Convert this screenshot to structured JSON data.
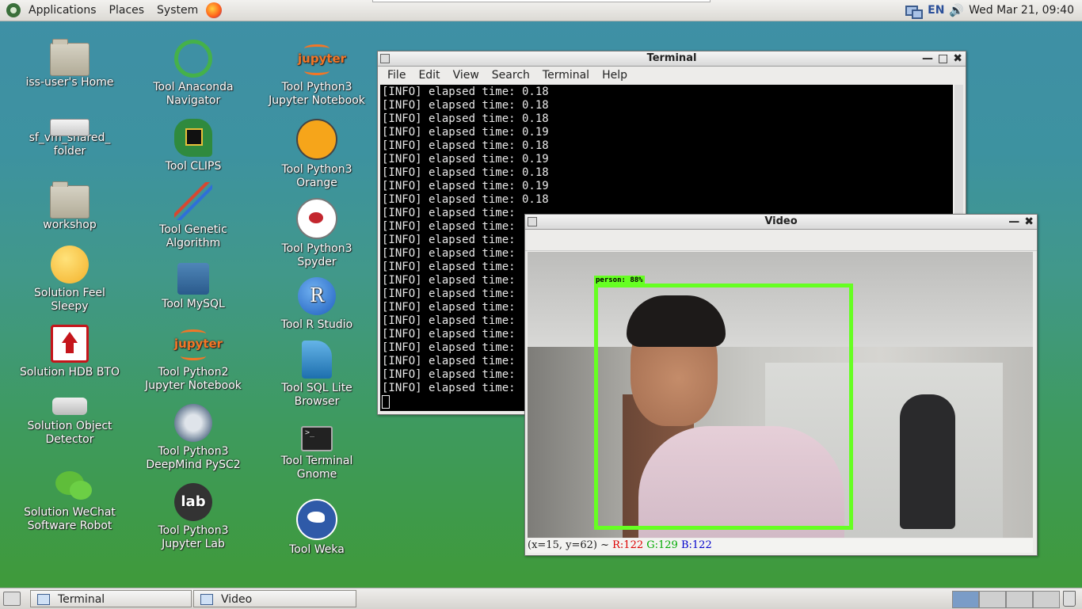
{
  "top_panel": {
    "menus": [
      "Applications",
      "Places",
      "System"
    ],
    "language": "EN",
    "clock": "Wed Mar 21, 09:40"
  },
  "desktop_icons": {
    "col1": [
      {
        "label": "iss-user's Home",
        "icon": "home-folder-icon"
      },
      {
        "label": "sf_vm_shared_\nfolder",
        "icon": "drive-icon"
      },
      {
        "label": "workshop",
        "icon": "folder-icon"
      },
      {
        "label": "Solution Feel\nSleepy",
        "icon": "sleepy-face-icon"
      },
      {
        "label": "Solution HDB BTO",
        "icon": "hdb-house-icon"
      },
      {
        "label": "Solution Object\nDetector",
        "icon": "security-camera-icon"
      },
      {
        "label": "Solution WeChat\nSoftware Robot",
        "icon": "wechat-icon"
      }
    ],
    "col2": [
      {
        "label": "Tool Anaconda\nNavigator",
        "icon": "anaconda-icon"
      },
      {
        "label": "Tool CLIPS",
        "icon": "clips-icon"
      },
      {
        "label": "Tool Genetic\nAlgorithm",
        "icon": "dna-icon"
      },
      {
        "label": "Tool MySQL",
        "icon": "mysql-icon"
      },
      {
        "label": "Tool Python2\nJupyter Notebook",
        "icon": "jupyter-icon"
      },
      {
        "label": "Tool Python3\nDeepMind PySC2",
        "icon": "starcraft-icon"
      },
      {
        "label": "Tool Python3\nJupyter Lab",
        "icon": "jupyterlab-icon"
      }
    ],
    "col3": [
      {
        "label": "Tool Python3\nJupyter Notebook",
        "icon": "jupyter-icon"
      },
      {
        "label": "Tool Python3\nOrange",
        "icon": "orange-icon"
      },
      {
        "label": "Tool Python3\nSpyder",
        "icon": "spyder-icon"
      },
      {
        "label": "Tool R Studio",
        "icon": "rstudio-icon"
      },
      {
        "label": "Tool SQL Lite\nBrowser",
        "icon": "sqlite-icon"
      },
      {
        "label": "Tool Terminal\nGnome",
        "icon": "terminal-icon"
      },
      {
        "label": "Tool Weka",
        "icon": "weka-icon"
      }
    ]
  },
  "icon_glyph_text": {
    "jupyter": "jupyter",
    "lab": "lab",
    "r": "R",
    "term": ">_"
  },
  "terminal": {
    "title": "Terminal",
    "menu": [
      "File",
      "Edit",
      "View",
      "Search",
      "Terminal",
      "Help"
    ],
    "lines": [
      "[INFO] elapsed time: 0.18",
      "[INFO] elapsed time: 0.18",
      "[INFO] elapsed time: 0.18",
      "[INFO] elapsed time: 0.19",
      "[INFO] elapsed time: 0.18",
      "[INFO] elapsed time: 0.19",
      "[INFO] elapsed time: 0.18",
      "[INFO] elapsed time: 0.19",
      "[INFO] elapsed time: 0.18",
      "[INFO] elapsed time:",
      "[INFO] elapsed time:",
      "[INFO] elapsed time:",
      "[INFO] elapsed time:",
      "[INFO] elapsed time:",
      "[INFO] elapsed time:",
      "[INFO] elapsed time:",
      "[INFO] elapsed time:",
      "[INFO] elapsed time:",
      "[INFO] elapsed time:",
      "[INFO] elapsed time:",
      "[INFO] elapsed time:",
      "[INFO] elapsed time:",
      "[INFO] elapsed time:"
    ]
  },
  "video": {
    "title": "Video",
    "detection_label": "person: 88%",
    "detection_confidence": 0.88,
    "status_coords": "(x=15, y=62) ~",
    "status_r": "R:122",
    "status_g": "G:129",
    "status_b": "B:122"
  },
  "taskbar": {
    "tasks": [
      {
        "label": "Terminal"
      },
      {
        "label": "Video"
      }
    ]
  },
  "colors": {
    "detection_box": "#66ff22",
    "terminal_bg": "#000000",
    "terminal_fg": "#e8e8e8"
  }
}
